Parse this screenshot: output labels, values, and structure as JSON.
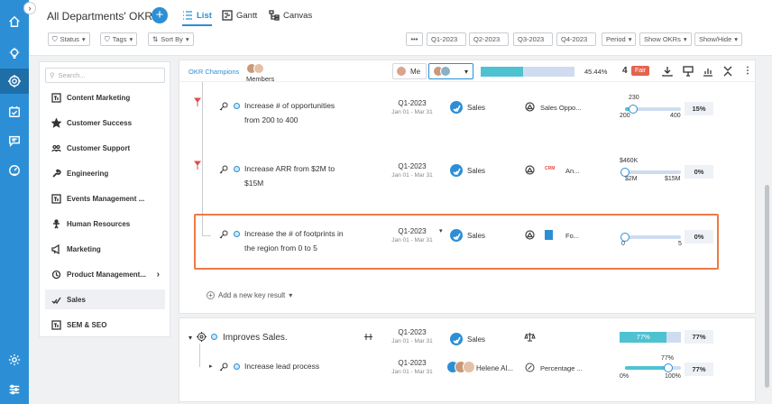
{
  "app": {
    "title": "All Departments' OKRs"
  },
  "views": [
    {
      "label": "List",
      "active": true,
      "icon": "list-icon"
    },
    {
      "label": "Gantt",
      "active": false,
      "icon": "gantt-icon"
    },
    {
      "label": "Canvas",
      "active": false,
      "icon": "canvas-icon"
    }
  ],
  "filters": {
    "status": "Status",
    "tags": "Tags",
    "sort_by": "Sort By",
    "more": "•••",
    "quarters": [
      "Q1-2023",
      "Q2-2023",
      "Q3-2023",
      "Q4-2023"
    ],
    "period": "Period",
    "show_okrs": "Show OKRs",
    "show_hide": "Show/Hide"
  },
  "sidebar": {
    "search_placeholder": "Search...",
    "departments": [
      {
        "label": "Content Marketing",
        "icon": "tb-icon"
      },
      {
        "label": "Customer Success",
        "icon": "star-icon"
      },
      {
        "label": "Customer Support",
        "icon": "people-icon"
      },
      {
        "label": "Engineering",
        "icon": "wrench-icon"
      },
      {
        "label": "Events Management ...",
        "icon": "tb-icon"
      },
      {
        "label": "Human Resources",
        "icon": "person-icon"
      },
      {
        "label": "Marketing",
        "icon": "megaphone-icon"
      },
      {
        "label": "Product Management...",
        "icon": "history-icon",
        "has_children": true
      },
      {
        "label": "Sales",
        "icon": "sales-icon",
        "active": true
      },
      {
        "label": "SEM & SEO",
        "icon": "tb-icon"
      }
    ]
  },
  "topbar": {
    "okr_champions": "OKR Champions",
    "members": "Members",
    "me": "Me",
    "progress_pct": 45.44,
    "progress_label": "45.44%",
    "count": "4",
    "status_badge": "Fair",
    "status_color": "#e5634e"
  },
  "key_results": [
    {
      "title_line1": "Increase # of opportunities",
      "title_line2": "from 200 to 400",
      "quarter": "Q1-2023",
      "range": "Jan 01 - Mar 31",
      "team": "Sales",
      "alignment": "Sales Oppo...",
      "slider": {
        "start": "200",
        "end": "400",
        "current": "230",
        "fraction": 0.15
      },
      "percent": "15%"
    },
    {
      "title_line1": "Increase ARR from $2M to",
      "title_line2": "$15M",
      "quarter": "Q1-2023",
      "range": "Jan 01 - Mar 31",
      "team": "Sales",
      "alignment_logo": "CRM",
      "alignment": "An...",
      "slider": {
        "start": "$2M",
        "end": "$15M",
        "current": "$460K",
        "fraction": 0.0
      },
      "percent": "0%"
    },
    {
      "title_line1": "Increase the # of footprints in",
      "title_line2": "the region from 0 to 5",
      "quarter": "Q1-2023",
      "range": "Jan 01 - Mar 31",
      "team": "Sales",
      "alignment": "Fo...",
      "slider": {
        "start": "0",
        "end": "5",
        "fraction": 0.0
      },
      "percent": "0%"
    }
  ],
  "add_key_result": "Add a new key result",
  "objective": {
    "title": "Improves Sales.",
    "quarter": "Q1-2023",
    "range": "Jan 01 - Mar 31",
    "team": "Sales",
    "progress": 0.77,
    "progress_label": "77%",
    "percent": "77%",
    "child": {
      "title": "Increase lead process",
      "quarter": "Q1-2023",
      "range": "Jan 01 - Mar 31",
      "owner": "Helene Al...",
      "metric_type": "Percentage ...",
      "slider": {
        "start": "0%",
        "end": "100%",
        "current": "77%",
        "fraction": 0.77
      },
      "percent": "77%"
    }
  },
  "colors": {
    "accent": "#2c8fd6",
    "teal": "#4fc2d1",
    "highlight": "#ee7a44"
  }
}
